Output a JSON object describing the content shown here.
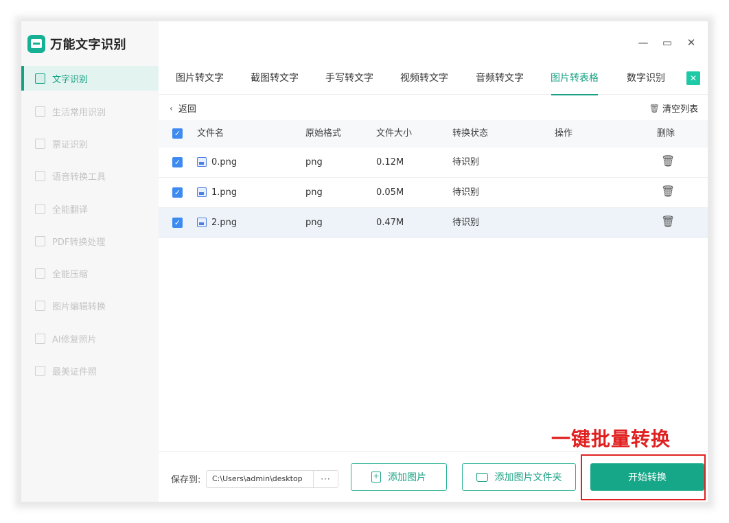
{
  "app": {
    "title": "万能文字识别"
  },
  "window_controls": {
    "minimize": "—",
    "maximize": "▭",
    "close": "✕"
  },
  "sidebar": {
    "items": [
      {
        "label": "文字识别",
        "active": true
      },
      {
        "label": "生活常用识别"
      },
      {
        "label": "票证识别"
      },
      {
        "label": "语音转换工具"
      },
      {
        "label": "全能翻译"
      },
      {
        "label": "PDF转换处理"
      },
      {
        "label": "全能压缩"
      },
      {
        "label": "图片编辑转换"
      },
      {
        "label": "AI修复照片"
      },
      {
        "label": "最美证件照"
      }
    ]
  },
  "tabs": [
    {
      "label": "图片转文字"
    },
    {
      "label": "截图转文字"
    },
    {
      "label": "手写转文字"
    },
    {
      "label": "视频转文字"
    },
    {
      "label": "音频转文字"
    },
    {
      "label": "图片转表格",
      "active": true
    },
    {
      "label": "数字识别"
    }
  ],
  "toolbar": {
    "back": "返回",
    "clear_list": "清空列表"
  },
  "table": {
    "headers": [
      "文件名",
      "原始格式",
      "文件大小",
      "转换状态",
      "操作",
      "删除"
    ],
    "rows": [
      {
        "name": "0.png",
        "format": "png",
        "size": "0.12M",
        "status": "待识别"
      },
      {
        "name": "1.png",
        "format": "png",
        "size": "0.05M",
        "status": "待识别"
      },
      {
        "name": "2.png",
        "format": "png",
        "size": "0.47M",
        "status": "待识别"
      }
    ]
  },
  "bottom": {
    "save_label": "保存到:",
    "save_path": "C:\\Users\\admin\\desktop",
    "browse": "···",
    "add_image": "添加图片",
    "add_folder": "添加图片文件夹",
    "start": "开始转换"
  },
  "annotation": {
    "text": "一键批量转换",
    "color": "#e02020"
  },
  "colors": {
    "accent": "#16a085",
    "checkbox": "#3d8bf0"
  }
}
